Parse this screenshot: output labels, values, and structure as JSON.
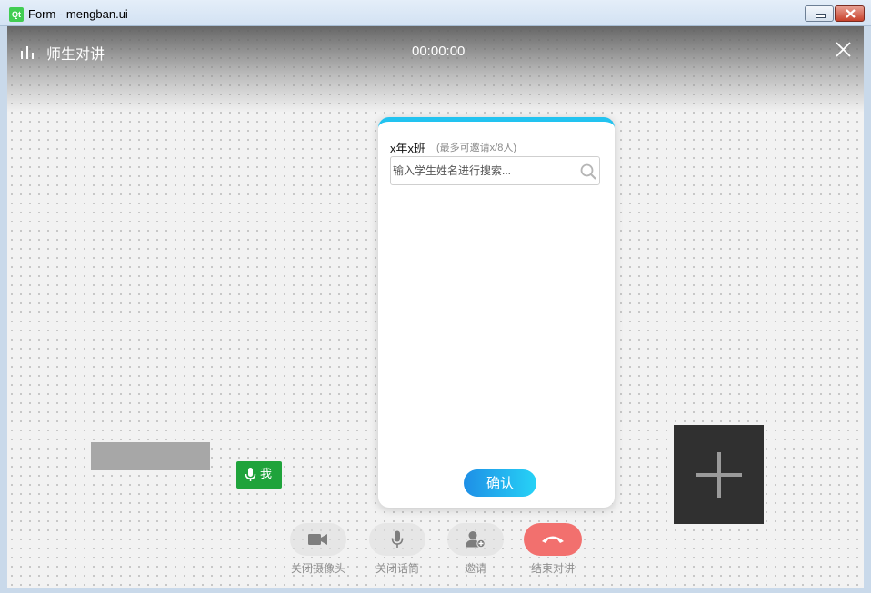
{
  "window": {
    "title": "Form - mengban.ui",
    "logo_text": "Qt"
  },
  "header": {
    "title": "师生对讲",
    "timer": "00:00:00"
  },
  "local_user": {
    "label": "我"
  },
  "invite_dialog": {
    "class_name": "x年x班",
    "hint": "(最多可邀请x/8人)",
    "search_placeholder": "输入学生姓名进行搜索...",
    "confirm_label": "确认"
  },
  "controls": {
    "camera_label": "关闭摄像头",
    "mic_label": "关闭话筒",
    "invite_label": "邀请",
    "end_label": "结束对讲"
  },
  "colors": {
    "accent_blue": "#22c3f0",
    "end_red": "#f2706e",
    "mic_green": "#1fa33b",
    "add_tile": "#303030"
  }
}
